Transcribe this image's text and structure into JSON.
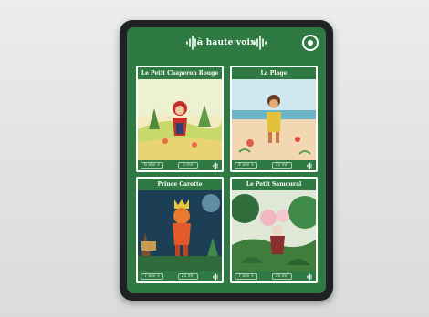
{
  "app": {
    "title": "à haute voix"
  },
  "stories": [
    {
      "title": "Le Petit Chaperon Rouge",
      "age": "6 ans +",
      "duration": "5 mn"
    },
    {
      "title": "La Plage",
      "age": "4 ans +",
      "duration": "15 mn"
    },
    {
      "title": "Prince Carotte",
      "age": "7 ans +",
      "duration": "25 mn"
    },
    {
      "title": "Le Petit Samouraï",
      "age": "7 ans +",
      "duration": "20 mn"
    }
  ],
  "icons": {
    "logo_left": "sound-wave-icon",
    "logo_right": "sound-wave-icon",
    "settings": "settings-icon",
    "card_action": "sound-wave-icon"
  },
  "colors": {
    "screen_bg": "#2f7a43",
    "frame": "#1f2124",
    "card_border": "#ffffff"
  }
}
